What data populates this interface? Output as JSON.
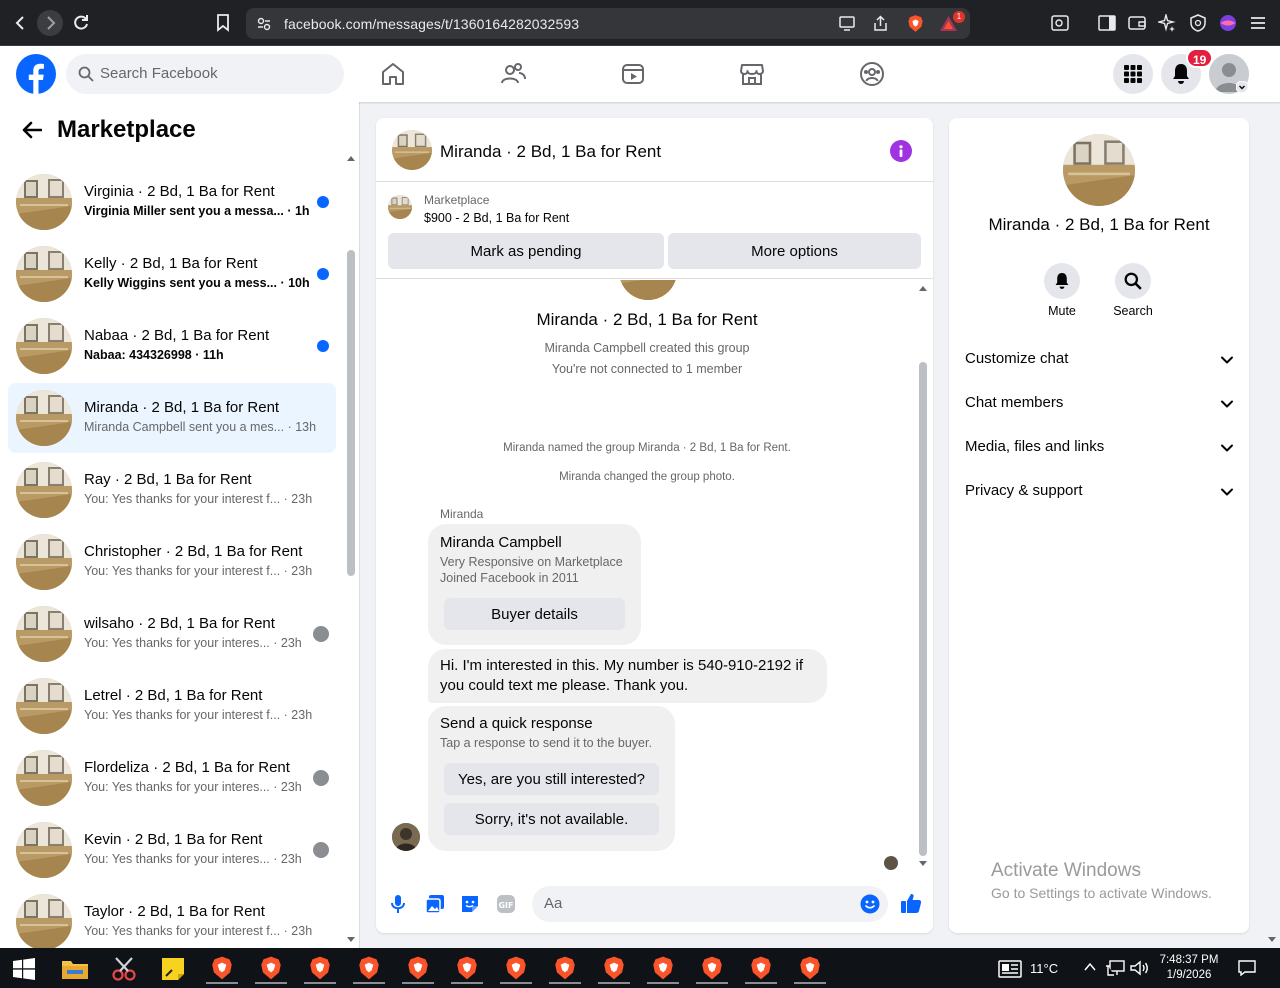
{
  "browser": {
    "url": "facebook.com/messages/t/1360164282032593",
    "extension_badge": "1"
  },
  "facebook": {
    "search_placeholder": "Search Facebook",
    "notification_count": "19"
  },
  "sidebar": {
    "title": "Marketplace",
    "conversations": [
      {
        "name": "Virginia · 2 Bd, 1 Ba for Rent",
        "preview": "Virginia Miller sent you a messa... · 1h",
        "unread": true
      },
      {
        "name": "Kelly · 2 Bd, 1 Ba for Rent",
        "preview": "Kelly Wiggins sent you a mess... · 10h",
        "unread": true
      },
      {
        "name": "Nabaa · 2 Bd, 1 Ba for Rent",
        "preview": "Nabaa: 434326998 · 11h",
        "unread": true
      },
      {
        "name": "Miranda · 2 Bd, 1 Ba for Rent",
        "preview": "Miranda Campbell sent you a mes... · 13h",
        "active": true
      },
      {
        "name": "Ray · 2 Bd, 1 Ba for Rent",
        "preview": "You: Yes thanks for your interest f... · 23h"
      },
      {
        "name": "Christopher · 2 Bd, 1 Ba for Rent",
        "preview": "You: Yes thanks for your interest f... · 23h"
      },
      {
        "name": "wilsaho · 2 Bd, 1 Ba for Rent",
        "preview": "You: Yes thanks for your interes... · 23h",
        "seen_avatar": true
      },
      {
        "name": "Letrel · 2 Bd, 1 Ba for Rent",
        "preview": "You: Yes thanks for your interest f... · 23h"
      },
      {
        "name": "Flordeliza · 2 Bd, 1 Ba for Rent",
        "preview": "You: Yes thanks for your interes... · 23h",
        "seen_avatar": true
      },
      {
        "name": "Kevin · 2 Bd, 1 Ba for Rent",
        "preview": "You: Yes thanks for your interes... · 23h",
        "seen_avatar": true
      },
      {
        "name": "Taylor · 2 Bd, 1 Ba for Rent",
        "preview": "You: Yes thanks for your interest f... · 23h"
      }
    ]
  },
  "chat": {
    "title": "Miranda · 2 Bd, 1 Ba for Rent",
    "marketplace_label": "Marketplace",
    "listing": "$900 - 2 Bd, 1 Ba for Rent",
    "mark_pending": "Mark as pending",
    "more_options": "More options",
    "group_name": "Miranda · 2 Bd, 1 Ba for Rent",
    "created_by": "Miranda Campbell created this group",
    "not_connected": "You're not connected to 1 member",
    "event1": "Miranda named the group Miranda · 2 Bd, 1 Ba for Rent.",
    "event2": "Miranda changed the group photo.",
    "sender": "Miranda",
    "profile_card": {
      "name": "Miranda Campbell",
      "line1": "Very Responsive on Marketplace",
      "line2": "Joined Facebook in 2011",
      "button": "Buyer details"
    },
    "message": "Hi. I'm interested in this. My number is 540-910-2192 if you could text me please. Thank you.",
    "quick_response": {
      "title": "Send a quick response",
      "subtitle": "Tap a response to send it to the buyer.",
      "option1": "Yes, are you still interested?",
      "option2": "Sorry, it's not available."
    },
    "composer_placeholder": "Aa"
  },
  "details": {
    "name": "Miranda · 2 Bd, 1 Ba for Rent",
    "mute": "Mute",
    "search": "Search",
    "sections": [
      "Customize chat",
      "Chat members",
      "Media, files and links",
      "Privacy & support"
    ]
  },
  "watermark": {
    "line1": "Activate Windows",
    "line2": "Go to Settings to activate Windows."
  },
  "taskbar": {
    "temperature": "11°C",
    "time": "7:48:37 PM",
    "date": "1/9/2026"
  },
  "colors": {
    "fb_blue": "#0866ff",
    "active_conversation": "#ebf5ff",
    "notification_red": "#e41e3f",
    "info_purple": "#a033e0",
    "brave_orange": "#fb542b"
  }
}
